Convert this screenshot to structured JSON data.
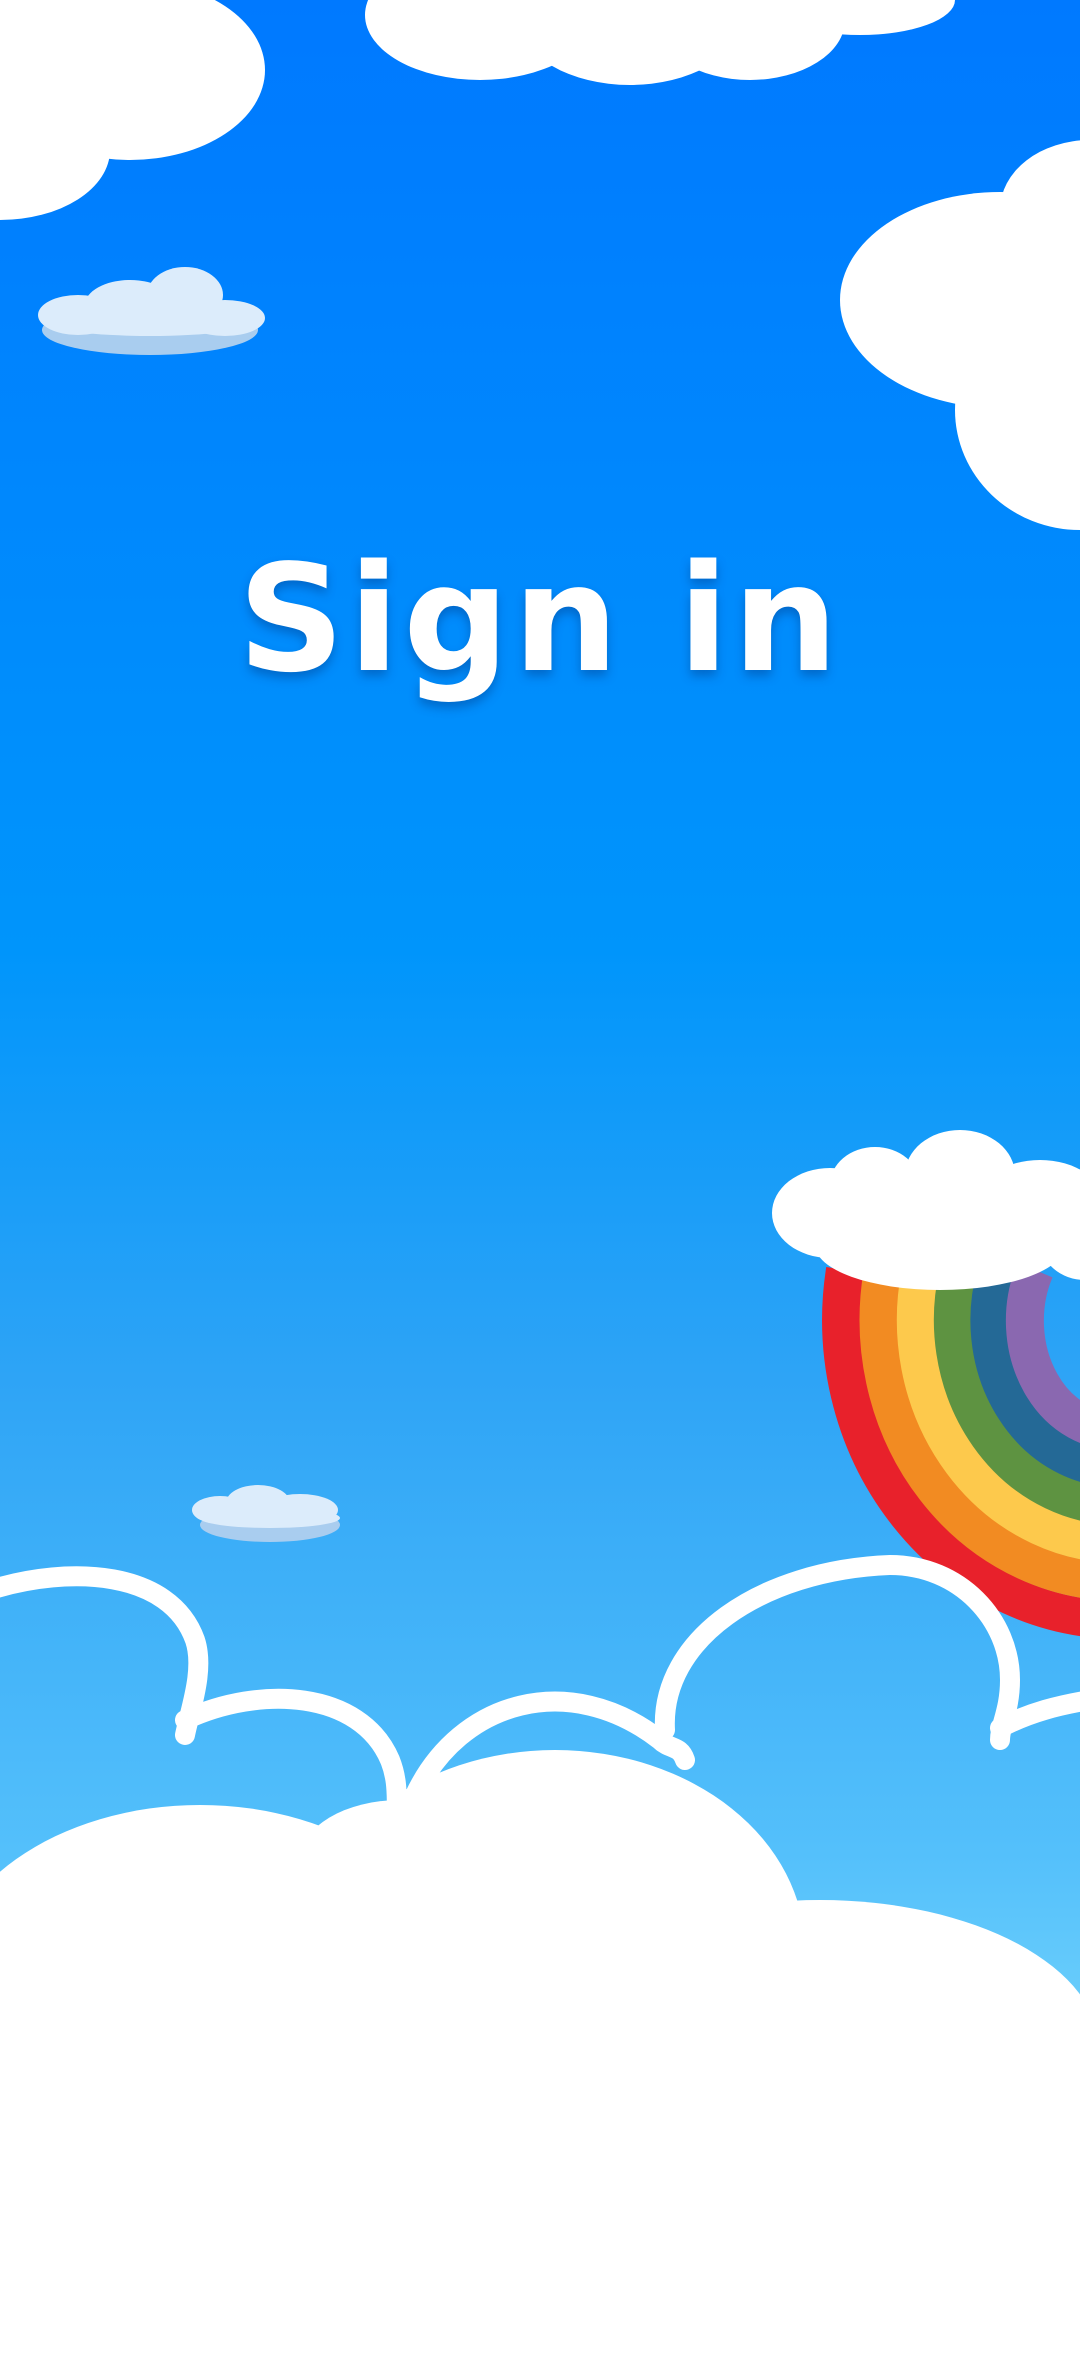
{
  "screen": {
    "title": "Sign in"
  },
  "colors": {
    "sky_top": "#0079ff",
    "sky_mid": "#0095fb",
    "sky_bottom": "#7ad8fb",
    "cloud": "#ffffff",
    "small_cloud": "#dcecfb",
    "small_cloud_shadow": "#a9cdef",
    "rainbow": [
      "#e8212b",
      "#f28b22",
      "#fdc94c",
      "#5e9341",
      "#246996",
      "#8a68b0"
    ]
  },
  "decorations": {
    "top_left_cloud": "cloud",
    "top_center_cloud": "cloud",
    "top_right_cloud": "cloud",
    "small_cloud_left": "cloud",
    "small_cloud_mid": "cloud",
    "rainbow": "rainbow",
    "bottom_cloud_bank": "cloud"
  }
}
